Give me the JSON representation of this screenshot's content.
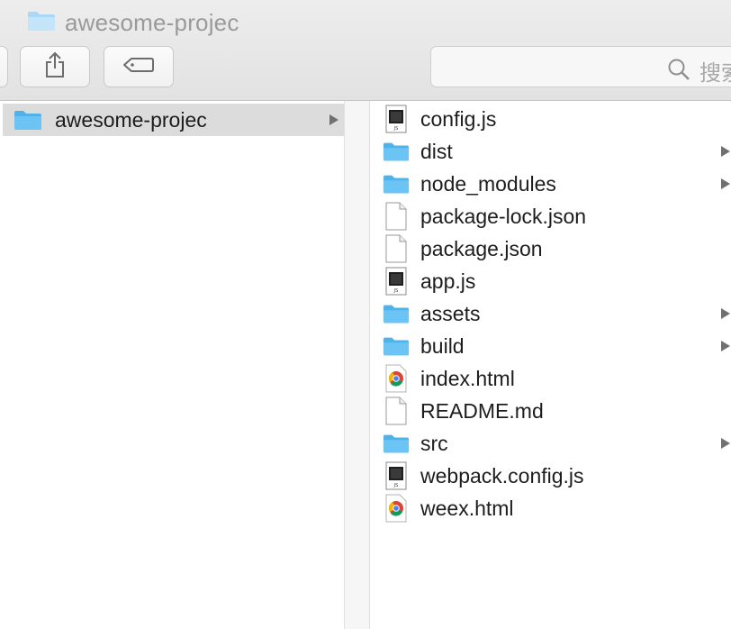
{
  "window": {
    "title": "awesome-projec"
  },
  "toolbar": {
    "share_icon": "share-icon",
    "tag_icon": "tag-icon",
    "search_placeholder": "搜索"
  },
  "sidebar_column": {
    "items": [
      {
        "label": "awesome-projec",
        "icon": "folder-icon",
        "selected": true,
        "has_children": true
      }
    ]
  },
  "files_column": {
    "items": [
      {
        "label": "config.js",
        "icon": "js-file-icon"
      },
      {
        "label": "dist",
        "icon": "folder-icon",
        "has_children": true
      },
      {
        "label": "node_modules",
        "icon": "folder-icon",
        "has_children": true
      },
      {
        "label": "package-lock.json",
        "icon": "document-icon"
      },
      {
        "label": "package.json",
        "icon": "document-icon"
      },
      {
        "label": "app.js",
        "icon": "js-file-icon"
      },
      {
        "label": "assets",
        "icon": "folder-icon",
        "has_children": true
      },
      {
        "label": "build",
        "icon": "folder-icon",
        "has_children": true
      },
      {
        "label": "index.html",
        "icon": "chrome-html-icon"
      },
      {
        "label": "README.md",
        "icon": "document-icon"
      },
      {
        "label": "src",
        "icon": "folder-icon",
        "has_children": true
      },
      {
        "label": "webpack.config.js",
        "icon": "js-file-icon"
      },
      {
        "label": "weex.html",
        "icon": "chrome-html-icon"
      }
    ]
  },
  "colors": {
    "folder": "#6cc4f5",
    "selection": "#dcdcdc",
    "toolbar_bg": "#e6e6e6"
  }
}
